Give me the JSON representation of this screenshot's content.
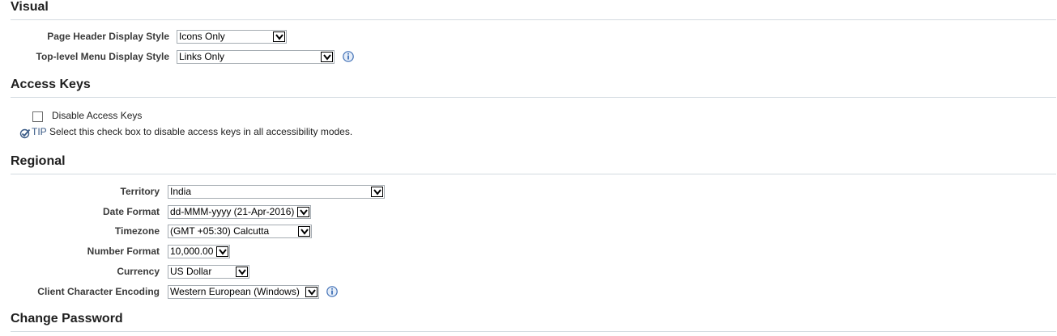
{
  "visual": {
    "title": "Visual",
    "page_header": {
      "label": "Page Header Display Style",
      "value": "Icons Only"
    },
    "top_menu": {
      "label": "Top-level Menu Display Style",
      "value": "Links Only"
    }
  },
  "access_keys": {
    "title": "Access Keys",
    "checkbox_label": "Disable Access Keys",
    "tip_label": "TIP",
    "tip_text": "Select this check box to disable access keys in all accessibility modes."
  },
  "regional": {
    "title": "Regional",
    "territory": {
      "label": "Territory",
      "value": "India"
    },
    "date_format": {
      "label": "Date Format",
      "value": "dd-MMM-yyyy (21-Apr-2016)"
    },
    "timezone": {
      "label": "Timezone",
      "value": "(GMT +05:30) Calcutta"
    },
    "number_format": {
      "label": "Number Format",
      "value": "10,000.00"
    },
    "currency": {
      "label": "Currency",
      "value": "US Dollar"
    },
    "encoding": {
      "label": "Client Character Encoding",
      "value": "Western European (Windows)"
    }
  },
  "change_password": {
    "title": "Change Password"
  },
  "icons": {
    "info": "info-icon",
    "tip": "tip-check-icon",
    "dropdown": "chevron-down-icon"
  },
  "colors": {
    "rule": "#d3dae0",
    "tip_accent": "#3a5a86",
    "info_icon": "#3f6fb5"
  }
}
